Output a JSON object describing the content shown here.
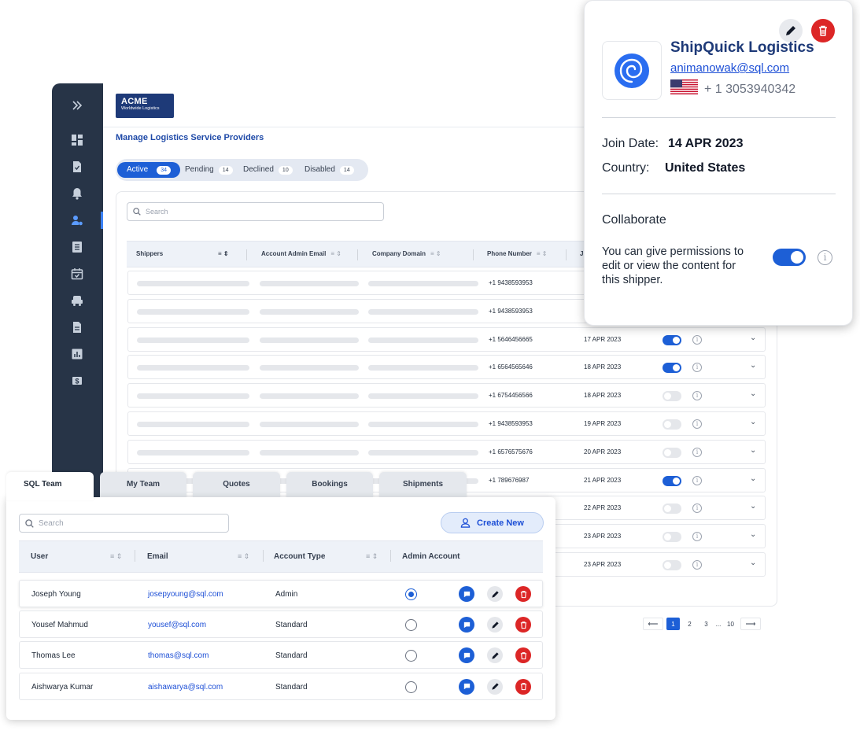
{
  "brand": {
    "logo_line1": "ACME",
    "logo_line2": "Worldwide Logistics"
  },
  "sidebar": {
    "icons": [
      "chevrons-right-icon",
      "dashboard-icon",
      "document-check-icon",
      "bell-icon",
      "user-settings-icon",
      "list-icon",
      "calendar-check-icon",
      "truck-icon",
      "file-icon",
      "chart-icon",
      "currency-icon"
    ]
  },
  "main": {
    "title": "Manage Logistics Service Providers",
    "status_tabs": [
      {
        "label": "Active",
        "count": "34"
      },
      {
        "label": "Pending",
        "count": "14"
      },
      {
        "label": "Declined",
        "count": "10"
      },
      {
        "label": "Disabled",
        "count": "14"
      }
    ],
    "search_placeholder": "Search",
    "columns": [
      "Shippers",
      "Account Admin Email",
      "Company Domain",
      "Phone Number",
      "J"
    ],
    "rows": [
      {
        "phone": "+1 9438593953",
        "date": "",
        "collab": null
      },
      {
        "phone": "+1 9438593953",
        "date": "",
        "collab": null
      },
      {
        "phone": "+1 5646456665",
        "date": "17 APR 2023",
        "collab": true
      },
      {
        "phone": "+1 6564565646",
        "date": "18 APR 2023",
        "collab": true
      },
      {
        "phone": "+1 6754456566",
        "date": "18 APR 2023",
        "collab": false
      },
      {
        "phone": "+1 9438593953",
        "date": "19 APR 2023",
        "collab": false
      },
      {
        "phone": "+1 6576575676",
        "date": "20 APR 2023",
        "collab": false
      },
      {
        "phone": "+1 789676987",
        "date": "21 APR 2023",
        "collab": true
      },
      {
        "phone": "",
        "date": "22 APR 2023",
        "collab": false
      },
      {
        "phone": "",
        "date": "23 APR 2023",
        "collab": false
      },
      {
        "phone": "",
        "date": "23 APR 2023",
        "collab": false
      }
    ],
    "pagination": {
      "prev": "⟵",
      "pages": [
        "1",
        "2",
        "3"
      ],
      "ellipsis": "...",
      "last": "10",
      "next": "⟶",
      "current": "1"
    }
  },
  "popup": {
    "company": "ShipQuick Logistics",
    "email": "animanowak@sql.com",
    "phone": "+ 1 3053940342",
    "join_label": "Join Date:",
    "join_value": "14 APR 2023",
    "country_label": "Country:",
    "country_value": "United States",
    "collab_title": "Collaborate",
    "collab_text_1": "You can give permissions to",
    "collab_text_2": "edit or view the content for",
    "collab_text_3": "this shipper.",
    "collab_on": true,
    "colors": {
      "brand": "#1e3a78",
      "accent": "#1d5fd6",
      "danger": "#dc2626"
    }
  },
  "team": {
    "tabs": [
      "SQL Team",
      "My Team",
      "Quotes",
      "Bookings",
      "Shipments"
    ],
    "active_tab": "SQL Team",
    "search_placeholder": "Search",
    "create_label": "Create New",
    "columns": [
      "User",
      "Email",
      "Account Type",
      "Admin Account"
    ],
    "users": [
      {
        "name": "Joseph Young",
        "email": "josepyoung@sql.com",
        "type": "Admin",
        "admin": true
      },
      {
        "name": "Yousef Mahmud",
        "email": "yousef@sql.com",
        "type": "Standard",
        "admin": false
      },
      {
        "name": "Thomas Lee",
        "email": "thomas@sql.com",
        "type": "Standard",
        "admin": false
      },
      {
        "name": "Aishwarya Kumar",
        "email": "aishawarya@sql.com",
        "type": "Standard",
        "admin": false
      }
    ]
  }
}
